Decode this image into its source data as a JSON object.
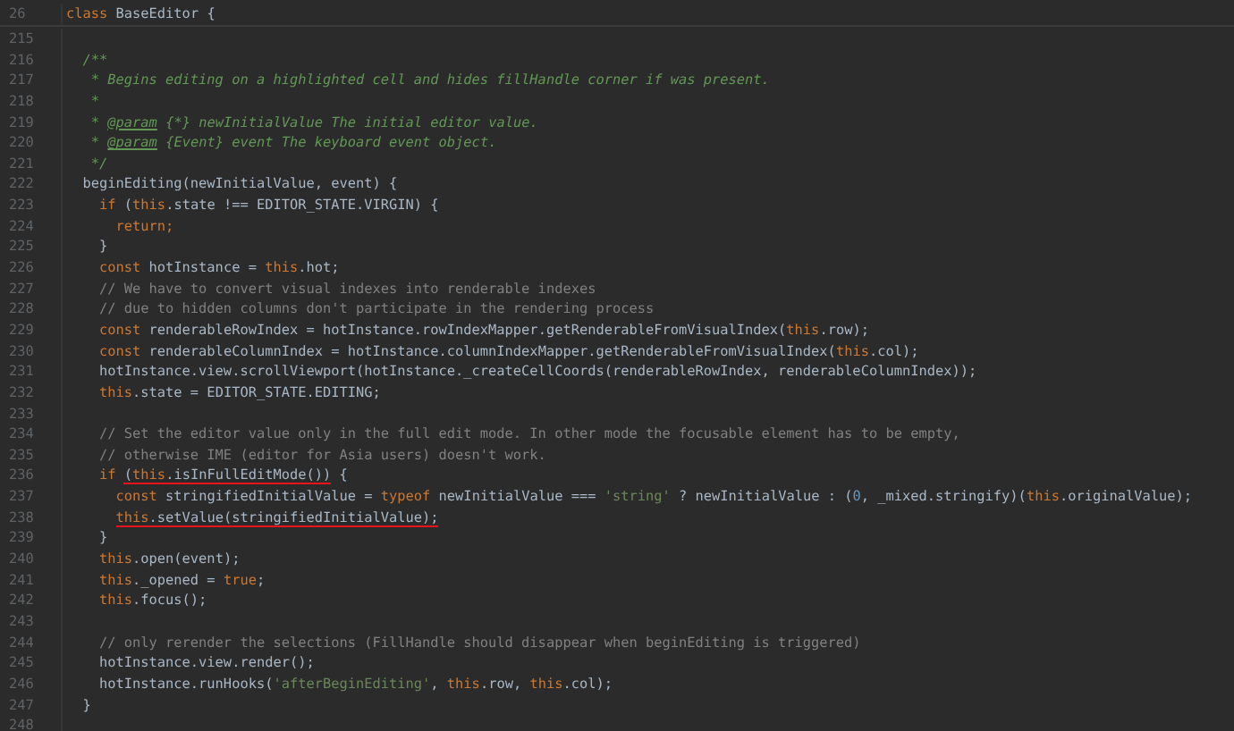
{
  "sticky_header": {
    "number": "26",
    "tokens": [
      {
        "kind": "kw",
        "text": "class"
      },
      {
        "kind": "plain",
        "text": " BaseEditor {"
      }
    ]
  },
  "lines": [
    {
      "number": "215"
    },
    {
      "number": "216",
      "tokens": [
        {
          "kind": "doc",
          "text": "  /**"
        }
      ]
    },
    {
      "number": "217",
      "tokens": [
        {
          "kind": "doc",
          "text": "   * Begins editing on a highlighted cell and hides fillHandle corner if was present."
        }
      ]
    },
    {
      "number": "218",
      "tokens": [
        {
          "kind": "doc",
          "text": "   *"
        }
      ]
    },
    {
      "number": "219",
      "tokens": [
        {
          "kind": "doc",
          "text": "   * "
        },
        {
          "kind": "doctag",
          "text": "@param"
        },
        {
          "kind": "doc",
          "text": " {*} newInitialValue The initial editor value."
        }
      ]
    },
    {
      "number": "220",
      "tokens": [
        {
          "kind": "doc",
          "text": "   * "
        },
        {
          "kind": "doctag",
          "text": "@param"
        },
        {
          "kind": "doc",
          "text": " {Event} event The keyboard event object."
        }
      ]
    },
    {
      "number": "221",
      "tokens": [
        {
          "kind": "doc",
          "text": "   */"
        }
      ]
    },
    {
      "number": "222",
      "tokens": [
        {
          "kind": "plain",
          "text": "  beginEditing(newInitialValue, event) {"
        }
      ]
    },
    {
      "number": "223",
      "tokens": [
        {
          "kind": "kw",
          "text": "    if"
        },
        {
          "kind": "plain",
          "text": " ("
        },
        {
          "kind": "kw",
          "text": "this"
        },
        {
          "kind": "plain",
          "text": ".state !== EDITOR_STATE.VIRGIN) {"
        }
      ]
    },
    {
      "number": "224",
      "tokens": [
        {
          "kind": "kw",
          "text": "      return;"
        }
      ]
    },
    {
      "number": "225",
      "tokens": [
        {
          "kind": "plain",
          "text": "    }"
        }
      ]
    },
    {
      "number": "226",
      "tokens": [
        {
          "kind": "kw",
          "text": "    const"
        },
        {
          "kind": "plain",
          "text": " hotInstance = "
        },
        {
          "kind": "kw",
          "text": "this"
        },
        {
          "kind": "plain",
          "text": ".hot;"
        }
      ]
    },
    {
      "number": "227",
      "tokens": [
        {
          "kind": "comment",
          "text": "    // We have to convert visual indexes into renderable indexes"
        }
      ]
    },
    {
      "number": "228",
      "tokens": [
        {
          "kind": "comment",
          "text": "    // due to hidden columns don't participate in the rendering process"
        }
      ]
    },
    {
      "number": "229",
      "tokens": [
        {
          "kind": "kw",
          "text": "    const"
        },
        {
          "kind": "plain",
          "text": " renderableRowIndex = hotInstance.rowIndexMapper.getRenderableFromVisualIndex("
        },
        {
          "kind": "kw",
          "text": "this"
        },
        {
          "kind": "plain",
          "text": ".row);"
        }
      ]
    },
    {
      "number": "230",
      "tokens": [
        {
          "kind": "kw",
          "text": "    const"
        },
        {
          "kind": "plain",
          "text": " renderableColumnIndex = hotInstance.columnIndexMapper.getRenderableFromVisualIndex("
        },
        {
          "kind": "kw",
          "text": "this"
        },
        {
          "kind": "plain",
          "text": ".col);"
        }
      ]
    },
    {
      "number": "231",
      "tokens": [
        {
          "kind": "plain",
          "text": "    hotInstance.view.scrollViewport(hotInstance._createCellCoords(renderableRowIndex, renderableColumnIndex));"
        }
      ]
    },
    {
      "number": "232",
      "tokens": [
        {
          "kind": "kw",
          "text": "    this"
        },
        {
          "kind": "plain",
          "text": ".state = EDITOR_STATE.EDITING;"
        }
      ]
    },
    {
      "number": "233"
    },
    {
      "number": "234",
      "tokens": [
        {
          "kind": "comment",
          "text": "    // Set the editor value only in the full edit mode. In other mode the focusable element has to be empty,"
        }
      ]
    },
    {
      "number": "235",
      "tokens": [
        {
          "kind": "comment",
          "text": "    // otherwise IME (editor for Asia users) doesn't work."
        }
      ]
    },
    {
      "number": "236",
      "tokens": [
        {
          "kind": "kw",
          "text": "    if ",
          "underlined": false
        },
        {
          "kind": "plain",
          "text": "(",
          "underlined": true
        },
        {
          "kind": "kw",
          "text": "this",
          "underlined": true
        },
        {
          "kind": "plain",
          "text": ".isInFullEditMode())",
          "underlined": true
        },
        {
          "kind": "plain",
          "text": " {",
          "underlined": false
        }
      ]
    },
    {
      "number": "237",
      "tokens": [
        {
          "kind": "kw",
          "text": "      const"
        },
        {
          "kind": "plain",
          "text": " stringifiedInitialValue = "
        },
        {
          "kind": "kw",
          "text": "typeof"
        },
        {
          "kind": "plain",
          "text": " newInitialValue === "
        },
        {
          "kind": "string",
          "text": "'string'"
        },
        {
          "kind": "plain",
          "text": " ? newInitialValue : ("
        },
        {
          "kind": "number",
          "text": "0"
        },
        {
          "kind": "plain",
          "text": ", _mixed.stringify)("
        },
        {
          "kind": "kw",
          "text": "this"
        },
        {
          "kind": "plain",
          "text": ".originalValue);"
        }
      ]
    },
    {
      "number": "238",
      "tokens": [
        {
          "kind": "kw",
          "text": "      this",
          "underlined": true
        },
        {
          "kind": "plain",
          "text": ".setValue(stringifiedInitialValue);",
          "underlined": true
        }
      ]
    },
    {
      "number": "239",
      "tokens": [
        {
          "kind": "plain",
          "text": "    }"
        }
      ]
    },
    {
      "number": "240",
      "tokens": [
        {
          "kind": "kw",
          "text": "    this"
        },
        {
          "kind": "plain",
          "text": ".open(event);"
        }
      ]
    },
    {
      "number": "241",
      "tokens": [
        {
          "kind": "kw",
          "text": "    this"
        },
        {
          "kind": "plain",
          "text": "._opened = "
        },
        {
          "kind": "kw",
          "text": "true"
        },
        {
          "kind": "plain",
          "text": ";"
        }
      ]
    },
    {
      "number": "242",
      "tokens": [
        {
          "kind": "kw",
          "text": "    this"
        },
        {
          "kind": "plain",
          "text": ".focus();"
        }
      ]
    },
    {
      "number": "243"
    },
    {
      "number": "244",
      "tokens": [
        {
          "kind": "comment",
          "text": "    // only rerender the selections (FillHandle should disappear when beginEditing is triggered)"
        }
      ]
    },
    {
      "number": "245",
      "tokens": [
        {
          "kind": "plain",
          "text": "    hotInstance.view.render();"
        }
      ]
    },
    {
      "number": "246",
      "tokens": [
        {
          "kind": "plain",
          "text": "    hotInstance.runHooks("
        },
        {
          "kind": "string",
          "text": "'afterBeginEditing'"
        },
        {
          "kind": "plain",
          "text": ", "
        },
        {
          "kind": "kw",
          "text": "this"
        },
        {
          "kind": "plain",
          "text": ".row, "
        },
        {
          "kind": "kw",
          "text": "this"
        },
        {
          "kind": "plain",
          "text": ".col);"
        }
      ]
    },
    {
      "number": "247",
      "tokens": [
        {
          "kind": "plain",
          "text": "  }"
        }
      ]
    },
    {
      "number": "248"
    }
  ]
}
